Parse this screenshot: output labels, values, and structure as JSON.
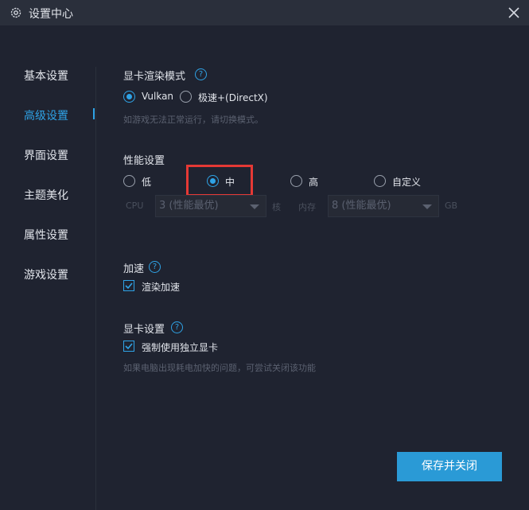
{
  "window": {
    "title": "设置中心",
    "close_icon": "close-icon"
  },
  "sidebar": {
    "items": [
      {
        "label": "基本设置",
        "active": false
      },
      {
        "label": "高级设置",
        "active": true
      },
      {
        "label": "界面设置",
        "active": false
      },
      {
        "label": "主题美化",
        "active": false
      },
      {
        "label": "属性设置",
        "active": false
      },
      {
        "label": "游戏设置",
        "active": false
      }
    ]
  },
  "render_mode": {
    "title": "显卡渲染模式",
    "options": [
      {
        "label": "Vulkan",
        "selected": true
      },
      {
        "label": "极速+(DirectX)",
        "selected": false
      }
    ],
    "hint": "如游戏无法正常运行，请切换模式。"
  },
  "performance": {
    "title": "性能设置",
    "options": [
      {
        "label": "低",
        "selected": false
      },
      {
        "label": "中",
        "selected": true
      },
      {
        "label": "高",
        "selected": false
      },
      {
        "label": "自定义",
        "selected": false
      }
    ],
    "cpu_label": "CPU",
    "cpu_value": "3 (性能最优)",
    "cpu_unit": "核",
    "mem_label": "内存",
    "mem_value": "8 (性能最优)",
    "mem_unit": "GB"
  },
  "acceleration": {
    "title": "加速",
    "checkbox_label": "渲染加速",
    "checked": true
  },
  "gpu": {
    "title": "显卡设置",
    "checkbox_label": "强制使用独立显卡",
    "checked": true,
    "hint": "如果电脑出现耗电加快的问题，可尝试关闭该功能"
  },
  "footer": {
    "save_label": "保存并关闭"
  },
  "colors": {
    "accent": "#2fa3e6",
    "background": "#1f2330",
    "button": "#2a9ad6",
    "highlight": "#e53935"
  }
}
